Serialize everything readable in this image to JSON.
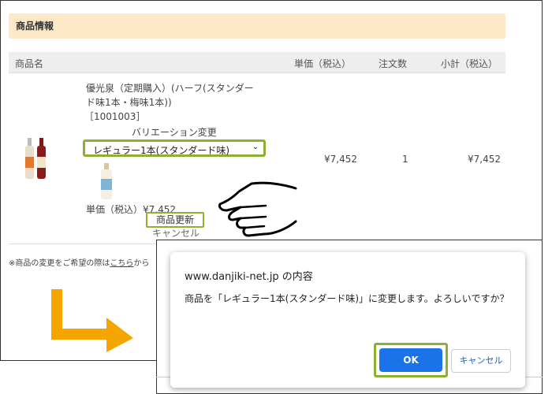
{
  "section": {
    "title": "商品情報"
  },
  "table": {
    "headers": {
      "name": "商品名",
      "unit_price": "単価（税込）",
      "qty": "注文数",
      "subtotal": "小計（税込）"
    }
  },
  "item": {
    "name_line1": "優光泉（定期購入）(ハーフ(スタンダー",
    "name_line2": "ド味1本・梅味1本))",
    "code": "［1001003］",
    "variation_label": "バリエーション変更",
    "selected_variation": "レギュラー1本(スタンダード味)",
    "unit_price_label": "単価（税込）¥7,452",
    "update_button": "商品更新",
    "cancel_link": "キャンセル",
    "unit_price": "¥7,452",
    "qty": "1",
    "subtotal": "¥7,452"
  },
  "note": {
    "prefix": "※商品の変更をご希望の際は",
    "link": "こちら",
    "suffix": "から"
  },
  "dialog": {
    "origin": "www.danjiki-net.jp の内容",
    "message": "商品を「レギュラー1本(スタンダード味)」に変更します。よろしいですか？",
    "ok": "OK",
    "cancel": "キャンセル"
  },
  "colors": {
    "accent_green": "#8db030",
    "arrow_orange": "#f5a500",
    "ok_blue": "#1a73e8",
    "header_bg": "#fde8c8"
  }
}
